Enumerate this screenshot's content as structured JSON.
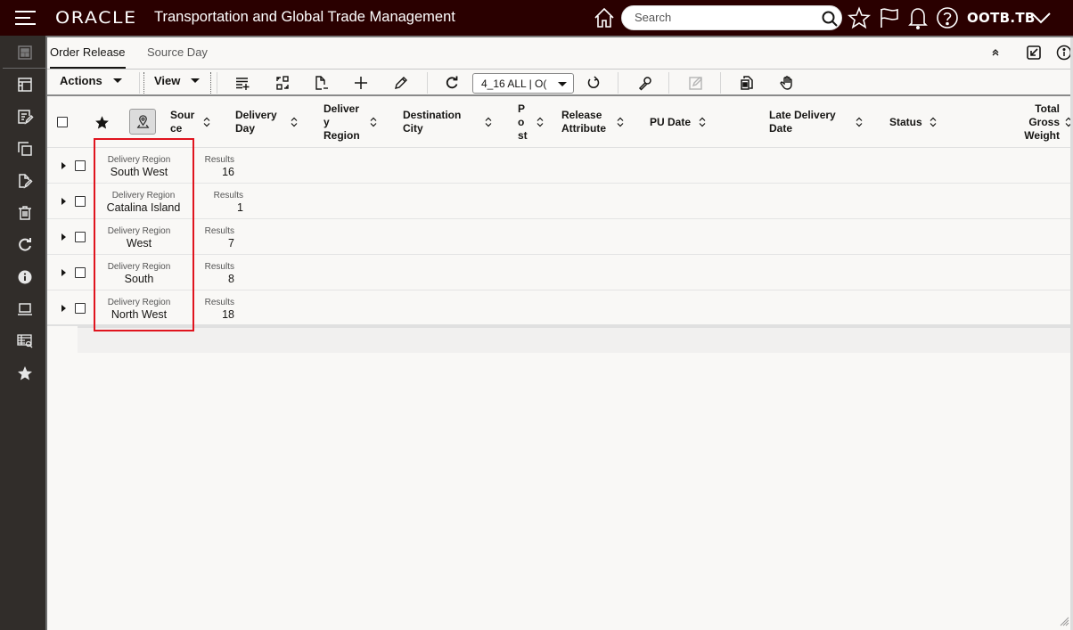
{
  "header": {
    "logo": "ORACLE",
    "app_title": "Transportation and Global Trade Management",
    "search_placeholder": "Search",
    "user": "OOTB.TB"
  },
  "sidebar": {
    "items": [
      {
        "icon": "dashboard-icon"
      },
      {
        "icon": "layout-icon"
      },
      {
        "icon": "edit-list-icon"
      },
      {
        "icon": "copy-icon"
      },
      {
        "icon": "edit-document-icon"
      },
      {
        "icon": "delete-icon"
      },
      {
        "icon": "refresh-icon"
      },
      {
        "icon": "info-icon"
      },
      {
        "icon": "monitor-icon"
      },
      {
        "icon": "search-table-icon"
      },
      {
        "icon": "favorite-icon"
      }
    ]
  },
  "tabs": [
    {
      "label": "Order Release",
      "active": true
    },
    {
      "label": "Source Day",
      "active": false
    }
  ],
  "toolbar": {
    "actions_label": "Actions",
    "view_label": "View",
    "saved_query": "4_16 ALL | O("
  },
  "table": {
    "columns": [
      {
        "label": "Sour ce"
      },
      {
        "label": "Delivery Day"
      },
      {
        "label": "Deliver y Region"
      },
      {
        "label": "Destination City"
      },
      {
        "label": "P o st"
      },
      {
        "label": "Release Attribute"
      },
      {
        "label": "PU Date"
      },
      {
        "label": "Late Delivery Date"
      },
      {
        "label": "Status"
      },
      {
        "label": "Total Gross Weight"
      }
    ],
    "col_lines": {
      "c0": [
        "Sour",
        "ce"
      ],
      "c1": [
        "Delivery",
        "Day"
      ],
      "c2": [
        "Deliver",
        "y",
        "Region"
      ],
      "c3": [
        "Destination",
        "City"
      ],
      "c4": [
        "P",
        "o",
        "st"
      ],
      "c5": [
        "Release",
        "Attribute"
      ],
      "c6": [
        "PU Date"
      ],
      "c7": [
        "Late Delivery",
        "Date"
      ],
      "c8": [
        "Status"
      ],
      "c9": [
        "Total",
        "Gross",
        "Weight"
      ]
    },
    "group_label": "Delivery Region",
    "results_label": "Results",
    "groups": [
      {
        "region": "South West",
        "results": "16"
      },
      {
        "region": "Catalina Island",
        "results": "1"
      },
      {
        "region": "West",
        "results": "7"
      },
      {
        "region": "South",
        "results": "8"
      },
      {
        "region": "North West",
        "results": "18"
      }
    ]
  },
  "colors": {
    "header_bg": "#2a0000",
    "sidebar_bg": "#312d2a",
    "highlight": "#e0141e"
  }
}
